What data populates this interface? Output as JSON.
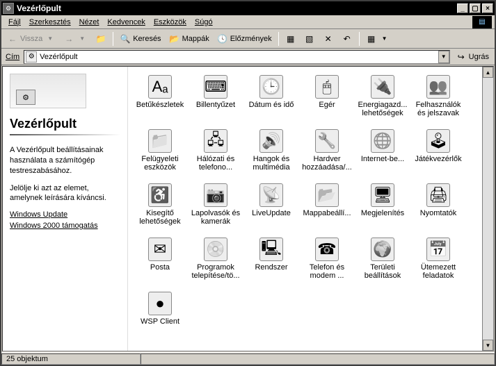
{
  "window": {
    "title": "Vezérlőpult"
  },
  "menubar": {
    "items": [
      {
        "label": "Fájl",
        "ul": 0
      },
      {
        "label": "Szerkesztés",
        "ul": 0
      },
      {
        "label": "Nézet",
        "ul": 0
      },
      {
        "label": "Kedvencek",
        "ul": 0
      },
      {
        "label": "Eszközök",
        "ul": 0
      },
      {
        "label": "Súgó",
        "ul": 0
      }
    ]
  },
  "toolbar": {
    "back": "Vissza",
    "search": "Keresés",
    "folders": "Mappák",
    "history": "Előzmények"
  },
  "addressbar": {
    "label": "Cím",
    "value": "Vezérlőpult",
    "go": "Ugrás"
  },
  "sidebar": {
    "title": "Vezérlőpult",
    "text1": "A Vezérlőpult beállításainak használata a számítógép testreszabásához.",
    "text2": "Jelölje ki azt az elemet, amelynek leírására kíváncsi.",
    "links": [
      "Windows Update",
      "Windows 2000 támogatás"
    ]
  },
  "items": [
    {
      "label": "Betűkészletek",
      "glyph": "Aₐ"
    },
    {
      "label": "Billentyűzet",
      "glyph": "⌨"
    },
    {
      "label": "Dátum és idő",
      "glyph": "🕒"
    },
    {
      "label": "Egér",
      "glyph": "🖱"
    },
    {
      "label": "Energiagazd... lehetőségek",
      "glyph": "🔌"
    },
    {
      "label": "Felhasználók és jelszavak",
      "glyph": "👥"
    },
    {
      "label": "Felügyeleti eszközök",
      "glyph": "📁"
    },
    {
      "label": "Hálózati és telefono...",
      "glyph": "🖧"
    },
    {
      "label": "Hangok és multimédia",
      "glyph": "🔊"
    },
    {
      "label": "Hardver hozzáadása/...",
      "glyph": "🔧"
    },
    {
      "label": "Internet-be...",
      "glyph": "🌐"
    },
    {
      "label": "Játékvezérlők",
      "glyph": "🕹"
    },
    {
      "label": "Kisegítő lehetőségek",
      "glyph": "♿"
    },
    {
      "label": "Lapolvasók és kamerák",
      "glyph": "📷"
    },
    {
      "label": "LiveUpdate",
      "glyph": "📡"
    },
    {
      "label": "Mappabeállí...",
      "glyph": "📂"
    },
    {
      "label": "Megjelenítés",
      "glyph": "🖥"
    },
    {
      "label": "Nyomtatók",
      "glyph": "🖨"
    },
    {
      "label": "Posta",
      "glyph": "✉"
    },
    {
      "label": "Programok telepítése/tö...",
      "glyph": "💿"
    },
    {
      "label": "Rendszer",
      "glyph": "🖳"
    },
    {
      "label": "Telefon és modem ...",
      "glyph": "☎"
    },
    {
      "label": "Területi beállítások",
      "glyph": "🌍"
    },
    {
      "label": "Ütemezett feladatok",
      "glyph": "📅"
    },
    {
      "label": "WSP Client",
      "glyph": "●"
    }
  ],
  "statusbar": {
    "text": "25 objektum"
  }
}
